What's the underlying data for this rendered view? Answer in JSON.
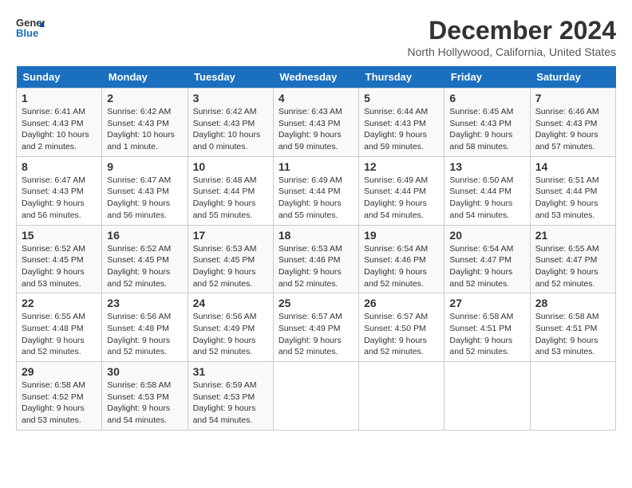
{
  "logo": {
    "line1": "General",
    "line2": "Blue"
  },
  "title": "December 2024",
  "subtitle": "North Hollywood, California, United States",
  "days_header": [
    "Sunday",
    "Monday",
    "Tuesday",
    "Wednesday",
    "Thursday",
    "Friday",
    "Saturday"
  ],
  "weeks": [
    [
      {
        "day": "1",
        "sunrise": "Sunrise: 6:41 AM",
        "sunset": "Sunset: 4:43 PM",
        "daylight": "Daylight: 10 hours and 2 minutes."
      },
      {
        "day": "2",
        "sunrise": "Sunrise: 6:42 AM",
        "sunset": "Sunset: 4:43 PM",
        "daylight": "Daylight: 10 hours and 1 minute."
      },
      {
        "day": "3",
        "sunrise": "Sunrise: 6:42 AM",
        "sunset": "Sunset: 4:43 PM",
        "daylight": "Daylight: 10 hours and 0 minutes."
      },
      {
        "day": "4",
        "sunrise": "Sunrise: 6:43 AM",
        "sunset": "Sunset: 4:43 PM",
        "daylight": "Daylight: 9 hours and 59 minutes."
      },
      {
        "day": "5",
        "sunrise": "Sunrise: 6:44 AM",
        "sunset": "Sunset: 4:43 PM",
        "daylight": "Daylight: 9 hours and 59 minutes."
      },
      {
        "day": "6",
        "sunrise": "Sunrise: 6:45 AM",
        "sunset": "Sunset: 4:43 PM",
        "daylight": "Daylight: 9 hours and 58 minutes."
      },
      {
        "day": "7",
        "sunrise": "Sunrise: 6:46 AM",
        "sunset": "Sunset: 4:43 PM",
        "daylight": "Daylight: 9 hours and 57 minutes."
      }
    ],
    [
      {
        "day": "8",
        "sunrise": "Sunrise: 6:47 AM",
        "sunset": "Sunset: 4:43 PM",
        "daylight": "Daylight: 9 hours and 56 minutes."
      },
      {
        "day": "9",
        "sunrise": "Sunrise: 6:47 AM",
        "sunset": "Sunset: 4:43 PM",
        "daylight": "Daylight: 9 hours and 56 minutes."
      },
      {
        "day": "10",
        "sunrise": "Sunrise: 6:48 AM",
        "sunset": "Sunset: 4:44 PM",
        "daylight": "Daylight: 9 hours and 55 minutes."
      },
      {
        "day": "11",
        "sunrise": "Sunrise: 6:49 AM",
        "sunset": "Sunset: 4:44 PM",
        "daylight": "Daylight: 9 hours and 55 minutes."
      },
      {
        "day": "12",
        "sunrise": "Sunrise: 6:49 AM",
        "sunset": "Sunset: 4:44 PM",
        "daylight": "Daylight: 9 hours and 54 minutes."
      },
      {
        "day": "13",
        "sunrise": "Sunrise: 6:50 AM",
        "sunset": "Sunset: 4:44 PM",
        "daylight": "Daylight: 9 hours and 54 minutes."
      },
      {
        "day": "14",
        "sunrise": "Sunrise: 6:51 AM",
        "sunset": "Sunset: 4:44 PM",
        "daylight": "Daylight: 9 hours and 53 minutes."
      }
    ],
    [
      {
        "day": "15",
        "sunrise": "Sunrise: 6:52 AM",
        "sunset": "Sunset: 4:45 PM",
        "daylight": "Daylight: 9 hours and 53 minutes."
      },
      {
        "day": "16",
        "sunrise": "Sunrise: 6:52 AM",
        "sunset": "Sunset: 4:45 PM",
        "daylight": "Daylight: 9 hours and 52 minutes."
      },
      {
        "day": "17",
        "sunrise": "Sunrise: 6:53 AM",
        "sunset": "Sunset: 4:45 PM",
        "daylight": "Daylight: 9 hours and 52 minutes."
      },
      {
        "day": "18",
        "sunrise": "Sunrise: 6:53 AM",
        "sunset": "Sunset: 4:46 PM",
        "daylight": "Daylight: 9 hours and 52 minutes."
      },
      {
        "day": "19",
        "sunrise": "Sunrise: 6:54 AM",
        "sunset": "Sunset: 4:46 PM",
        "daylight": "Daylight: 9 hours and 52 minutes."
      },
      {
        "day": "20",
        "sunrise": "Sunrise: 6:54 AM",
        "sunset": "Sunset: 4:47 PM",
        "daylight": "Daylight: 9 hours and 52 minutes."
      },
      {
        "day": "21",
        "sunrise": "Sunrise: 6:55 AM",
        "sunset": "Sunset: 4:47 PM",
        "daylight": "Daylight: 9 hours and 52 minutes."
      }
    ],
    [
      {
        "day": "22",
        "sunrise": "Sunrise: 6:55 AM",
        "sunset": "Sunset: 4:48 PM",
        "daylight": "Daylight: 9 hours and 52 minutes."
      },
      {
        "day": "23",
        "sunrise": "Sunrise: 6:56 AM",
        "sunset": "Sunset: 4:48 PM",
        "daylight": "Daylight: 9 hours and 52 minutes."
      },
      {
        "day": "24",
        "sunrise": "Sunrise: 6:56 AM",
        "sunset": "Sunset: 4:49 PM",
        "daylight": "Daylight: 9 hours and 52 minutes."
      },
      {
        "day": "25",
        "sunrise": "Sunrise: 6:57 AM",
        "sunset": "Sunset: 4:49 PM",
        "daylight": "Daylight: 9 hours and 52 minutes."
      },
      {
        "day": "26",
        "sunrise": "Sunrise: 6:57 AM",
        "sunset": "Sunset: 4:50 PM",
        "daylight": "Daylight: 9 hours and 52 minutes."
      },
      {
        "day": "27",
        "sunrise": "Sunrise: 6:58 AM",
        "sunset": "Sunset: 4:51 PM",
        "daylight": "Daylight: 9 hours and 52 minutes."
      },
      {
        "day": "28",
        "sunrise": "Sunrise: 6:58 AM",
        "sunset": "Sunset: 4:51 PM",
        "daylight": "Daylight: 9 hours and 53 minutes."
      }
    ],
    [
      {
        "day": "29",
        "sunrise": "Sunrise: 6:58 AM",
        "sunset": "Sunset: 4:52 PM",
        "daylight": "Daylight: 9 hours and 53 minutes."
      },
      {
        "day": "30",
        "sunrise": "Sunrise: 6:58 AM",
        "sunset": "Sunset: 4:53 PM",
        "daylight": "Daylight: 9 hours and 54 minutes."
      },
      {
        "day": "31",
        "sunrise": "Sunrise: 6:59 AM",
        "sunset": "Sunset: 4:53 PM",
        "daylight": "Daylight: 9 hours and 54 minutes."
      },
      null,
      null,
      null,
      null
    ]
  ]
}
